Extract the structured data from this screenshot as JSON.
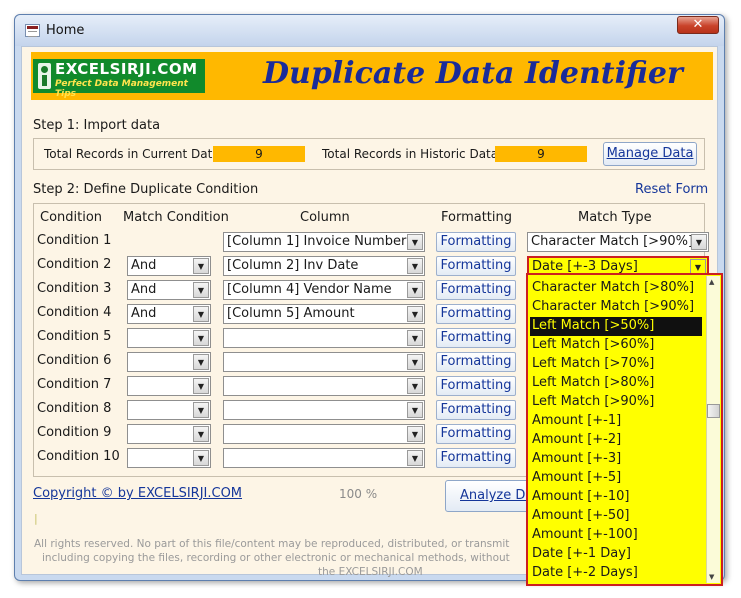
{
  "window": {
    "title": "Home",
    "close_glyph": "✕",
    "app_icon": "access-form-icon"
  },
  "banner": {
    "logo_text": "EXCELSIRJI.COM",
    "logo_tagline": "Perfect Data Management Tips",
    "title": "Duplicate Data Identifier"
  },
  "step1": {
    "label": "Step 1: Import data",
    "current_label": "Total Records in Current Data:",
    "current_value": "9",
    "historic_label": "Total Records in Historic Data:",
    "historic_value": "9",
    "manage_button": "Manage Data"
  },
  "step2": {
    "label": "Step 2: Define Duplicate Condition",
    "reset_link": "Reset Form",
    "headers": {
      "condition": "Condition",
      "match_condition": "Match Condition",
      "column": "Column",
      "formatting": "Formatting",
      "match_type": "Match Type"
    },
    "rows": [
      {
        "condition": "Condition 1",
        "match": "",
        "column": "[Column 1] Invoice Number",
        "formatting": "Formatting",
        "match_type": "Character Match [>90%]"
      },
      {
        "condition": "Condition 2",
        "match": "And",
        "column": "[Column 2] Inv Date",
        "formatting": "Formatting",
        "match_type": "Date [+-3 Days]"
      },
      {
        "condition": "Condition 3",
        "match": "And",
        "column": "[Column 4] Vendor Name",
        "formatting": "Formatting",
        "match_type": ""
      },
      {
        "condition": "Condition 4",
        "match": "And",
        "column": "[Column 5] Amount",
        "formatting": "Formatting",
        "match_type": ""
      },
      {
        "condition": "Condition 5",
        "match": "",
        "column": "",
        "formatting": "Formatting",
        "match_type": ""
      },
      {
        "condition": "Condition 6",
        "match": "",
        "column": "",
        "formatting": "Formatting",
        "match_type": ""
      },
      {
        "condition": "Condition 7",
        "match": "",
        "column": "",
        "formatting": "Formatting",
        "match_type": ""
      },
      {
        "condition": "Condition 8",
        "match": "",
        "column": "",
        "formatting": "Formatting",
        "match_type": ""
      },
      {
        "condition": "Condition 9",
        "match": "",
        "column": "",
        "formatting": "Formatting",
        "match_type": ""
      },
      {
        "condition": "Condition 10",
        "match": "",
        "column": "",
        "formatting": "Formatting",
        "match_type": ""
      }
    ]
  },
  "dropdown": {
    "options": [
      "Character Match [>80%]",
      "Character Match [>90%]",
      "Left Match [>50%]",
      "Left Match [>60%]",
      "Left Match [>70%]",
      "Left Match [>80%]",
      "Left Match [>90%]",
      "Amount [+-1]",
      "Amount [+-2]",
      "Amount [+-3]",
      "Amount [+-5]",
      "Amount [+-10]",
      "Amount [+-50]",
      "Amount [+-100]",
      "Date [+-1 Day]",
      "Date [+-2 Days]"
    ],
    "highlighted": "Left Match [>50%]"
  },
  "footer": {
    "copyright": "Copyright © by EXCELSIRJI.COM",
    "progress": "100 %",
    "analyze_button": "Analyze Da",
    "cursor_mark": "|",
    "legal_line1": "All rights reserved. No part of this file/content may be reproduced, distributed, or transmit",
    "legal_line2": "including copying the files, recording or other electronic or mechanical methods, without",
    "legal_line3": "the EXCELSIRJI.COM"
  },
  "colors": {
    "accent": "#ffb800",
    "title": "#1a2b99",
    "link": "#15369a",
    "dropdown_bg": "#ffff00",
    "dropdown_border": "#cc2020"
  }
}
